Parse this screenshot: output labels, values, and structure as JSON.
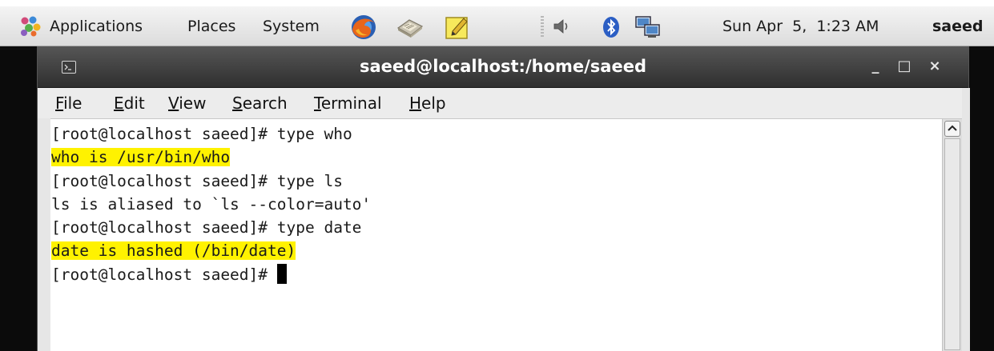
{
  "top_panel": {
    "menus": {
      "applications": "Applications",
      "places": "Places",
      "system": "System"
    },
    "launchers": [
      "firefox-icon",
      "mail-icon",
      "notes-icon"
    ],
    "tray": [
      "volume-icon",
      "bluetooth-icon",
      "network-icon"
    ],
    "clock": "Sun Apr  5,  1:23 AM",
    "user": "saeed"
  },
  "window": {
    "title": "saeed@localhost:/home/saeed",
    "controls": {
      "minimize": "_",
      "maximize": "□",
      "close": "×"
    }
  },
  "menubar": {
    "file": {
      "first": "F",
      "rest": "ile"
    },
    "edit": {
      "first": "E",
      "rest": "dit"
    },
    "view": {
      "first": "V",
      "rest": "iew"
    },
    "search": {
      "first": "S",
      "rest": "earch"
    },
    "terminal": {
      "first": "T",
      "rest": "erminal"
    },
    "help": {
      "first": "H",
      "rest": "elp"
    }
  },
  "terminal": {
    "lines": [
      "[root@localhost saeed]# type who",
      "who is /usr/bin/who",
      "[root@localhost saeed]# type ls",
      "ls is aliased to `ls --color=auto'",
      "[root@localhost saeed]# type date",
      "date is hashed (/bin/date)",
      "[root@localhost saeed]# "
    ],
    "highlight_color": "#fff200"
  },
  "colors": {
    "titlebar": "#3f3f3f",
    "panel": "#e6e6e6",
    "highlight": "#fff200"
  }
}
